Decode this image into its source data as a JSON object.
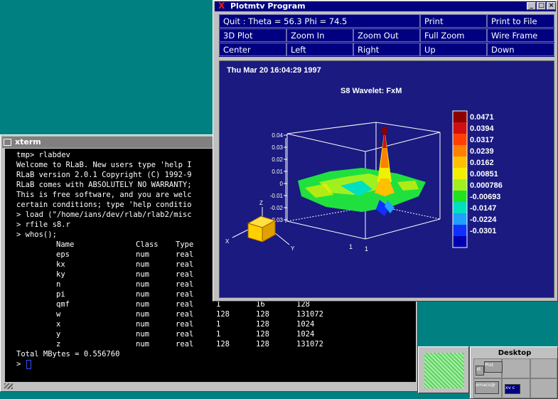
{
  "xterm": {
    "title": "xterm",
    "lines": [
      "tmp> rlabdev",
      "Welcome to RLaB. New users type 'help I",
      "RLaB version 2.0.1 Copyright (C) 1992-9",
      "RLaB comes with ABSOLUTELY NO WARRANTY;",
      "This is free software, and you are welc",
      "certain conditions; type 'help conditio",
      "> load (\"/home/ians/dev/rlab/rlab2/misc",
      "> rfile s8.r",
      "> whos();"
    ],
    "whos_header": [
      "Name",
      "Class",
      "Type"
    ],
    "whos_rows": [
      [
        "eps",
        "num",
        "real",
        "",
        "",
        ""
      ],
      [
        "kx",
        "num",
        "real",
        "",
        "",
        ""
      ],
      [
        "ky",
        "num",
        "real",
        "",
        "",
        ""
      ],
      [
        "n",
        "num",
        "real",
        "",
        "",
        ""
      ],
      [
        "pi",
        "num",
        "real",
        "",
        "",
        ""
      ],
      [
        "qmf",
        "num",
        "real",
        "1",
        "16",
        "128"
      ],
      [
        "w",
        "num",
        "real",
        "128",
        "128",
        "131072"
      ],
      [
        "x",
        "num",
        "real",
        "1",
        "128",
        "1024"
      ],
      [
        "y",
        "num",
        "real",
        "1",
        "128",
        "1024"
      ],
      [
        "z",
        "num",
        "real",
        "128",
        "128",
        "131072"
      ]
    ],
    "total": "Total MBytes = 0.556760",
    "prompt": ">"
  },
  "plot_window": {
    "title": "Plotmtv Program",
    "buttons": {
      "minimize": "_",
      "maximize": "□",
      "close": "×"
    },
    "menu": [
      [
        "Quit :  Theta = 56.3   Phi = 74.5",
        "Print",
        "Print to File"
      ],
      [
        "3D Plot",
        "Zoom In",
        "Zoom Out",
        "Full Zoom",
        "Wire Frame"
      ],
      [
        "Center",
        "Left",
        "Right",
        "Up",
        "Down"
      ]
    ],
    "date": "Thu Mar 20 16:04:29 1997",
    "plot_title": "S8 Wavelet: FxM",
    "axis_ticks": [
      "0.04",
      "0.03",
      "0.02",
      "0.01",
      "0",
      "-0.01",
      "-0.02",
      "-0.03"
    ],
    "x_tick": "1",
    "y_tick": "1",
    "axis_x": "X",
    "axis_y": "Y",
    "axis_z": "Z",
    "colorbar_labels": [
      "0.0471",
      "0.0394",
      "0.0317",
      "0.0239",
      "0.0162",
      "0.00851",
      "0.000786",
      "-0.00693",
      "-0.0147",
      "-0.0224",
      "-0.0301"
    ],
    "colorbar_colors": [
      "#8b0000",
      "#d01010",
      "#ff4000",
      "#ff8000",
      "#ffc000",
      "#f0f000",
      "#a0f020",
      "#20e020",
      "#00e0c0",
      "#20a0ff",
      "#1030ff",
      "#0000b0"
    ]
  },
  "pager": {
    "title": "Desktop",
    "windows": [
      "Plot",
      "xt",
      "emacs@",
      "xv c"
    ]
  },
  "colors": {
    "desktop": "#008080",
    "window_chrome": "#c0c0c0",
    "plot_bg": "#1a1a80",
    "menu_bg": "#000080"
  }
}
